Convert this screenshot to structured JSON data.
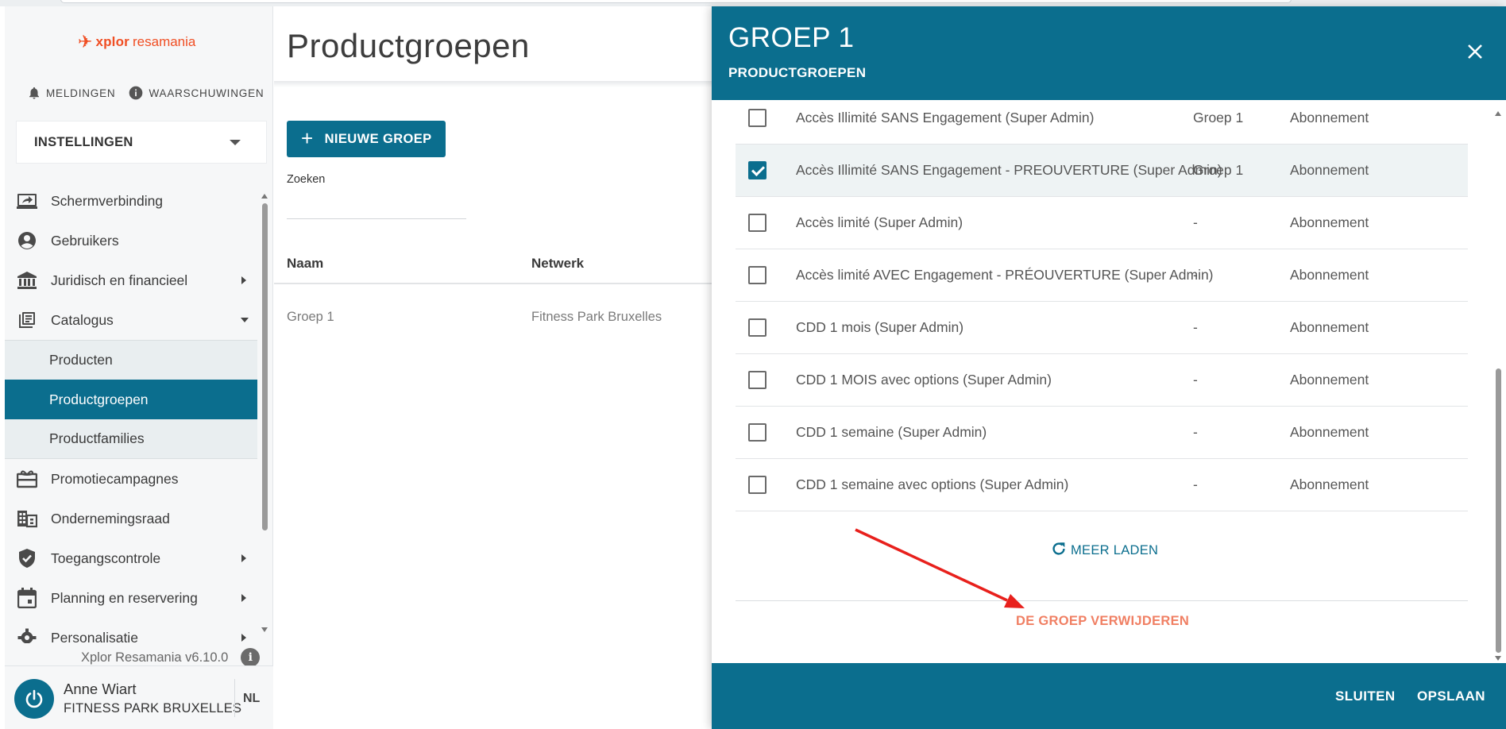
{
  "brand": {
    "mark": "✈",
    "name_bold": "xplor",
    "name_rest": " resamania",
    "color": "#f04e23"
  },
  "colors": {
    "primary": "#0b6e8e",
    "danger": "#f07f63",
    "annotation_arrow": "#e8201c"
  },
  "alerts": {
    "notifications": "MELDINGEN",
    "warnings": "WAARSCHUWINGEN",
    "notifications_icon": "bell-icon",
    "warnings_icon": "info-icon"
  },
  "settings_select": {
    "value": "INSTELLINGEN"
  },
  "nav": {
    "items": [
      {
        "label": "Schermverbinding",
        "icon": "screen-share-icon"
      },
      {
        "label": "Gebruikers",
        "icon": "account-circle-icon"
      },
      {
        "label": "Juridisch en financieel",
        "icon": "bank-icon"
      },
      {
        "label": "Catalogus",
        "icon": "library-books-icon"
      },
      {
        "label": "Promotiecampagnes",
        "icon": "card-giftcard-icon"
      },
      {
        "label": "Ondernemingsraad",
        "icon": "domain-icon"
      },
      {
        "label": "Toegangscontrole",
        "icon": "verified-user-icon"
      },
      {
        "label": "Planning en reservering",
        "icon": "event-icon"
      },
      {
        "label": "Personalisatie",
        "icon": "gear-icon"
      }
    ],
    "catalog_sub": [
      "Producten",
      "Productgroepen",
      "Productfamilies"
    ]
  },
  "version": {
    "text": "Xplor Resamania v6.10.0",
    "info": "i"
  },
  "user": {
    "name": "Anne Wiart",
    "org": "FITNESS PARK BRUXELLES",
    "lang": "NL"
  },
  "main": {
    "title": "Productgroepen",
    "new_group": "NIEUWE GROEP",
    "search_label": "Zoeken",
    "search_placeholder": "",
    "columns": [
      "Naam",
      "Netwerk"
    ],
    "rows": [
      {
        "name": "Groep 1",
        "network": "Fitness Park Bruxelles"
      }
    ]
  },
  "drawer": {
    "title": "GROEP 1",
    "subtitle": "PRODUCTGROEPEN",
    "products": [
      {
        "name": "Accès Illimité SANS Engagement (Super Admin)",
        "group": "Groep 1",
        "type": "Abonnement",
        "checked": false
      },
      {
        "name": "Accès Illimité SANS Engagement - PREOUVERTURE (Super Admin)",
        "group": "Groep 1",
        "type": "Abonnement",
        "checked": true
      },
      {
        "name": "Accès limité (Super Admin)",
        "group": "-",
        "type": "Abonnement",
        "checked": false
      },
      {
        "name": "Accès limité AVEC Engagement - PRÉOUVERTURE (Super Admin)",
        "group": "-",
        "type": "Abonnement",
        "checked": false
      },
      {
        "name": "CDD 1 mois (Super Admin)",
        "group": "-",
        "type": "Abonnement",
        "checked": false
      },
      {
        "name": "CDD 1 MOIS avec options (Super Admin)",
        "group": "-",
        "type": "Abonnement",
        "checked": false
      },
      {
        "name": "CDD 1 semaine (Super Admin)",
        "group": "-",
        "type": "Abonnement",
        "checked": false
      },
      {
        "name": "CDD 1 semaine avec options (Super Admin)",
        "group": "-",
        "type": "Abonnement",
        "checked": false
      }
    ],
    "load_more": "MEER LADEN",
    "delete_group": "DE GROEP VERWIJDEREN",
    "close": "SLUITEN",
    "save": "OPSLAAN"
  }
}
